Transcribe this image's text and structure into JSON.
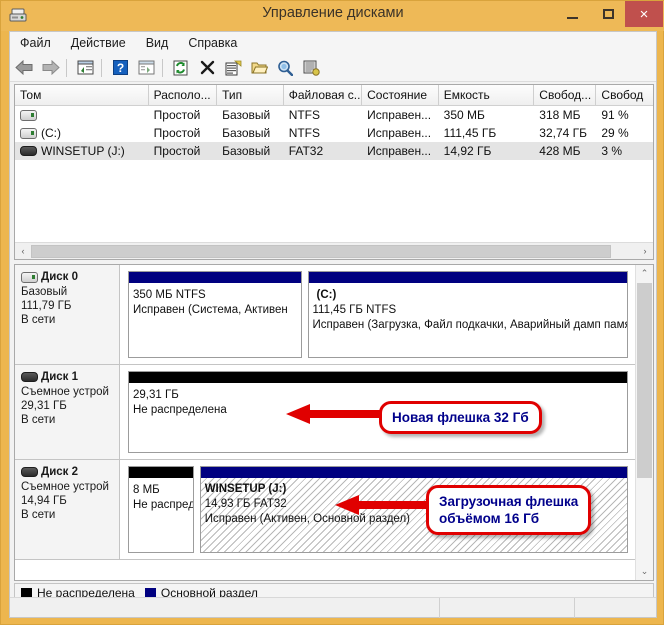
{
  "window": {
    "title": "Управление дисками",
    "icon": "disk-management-icon",
    "minimize_label": "",
    "maximize_label": "",
    "close_label": "×",
    "accent_color": "#eeb957",
    "close_color": "#c0504d"
  },
  "menu": {
    "items": [
      {
        "label": "Файл",
        "name": "menu-file"
      },
      {
        "label": "Действие",
        "name": "menu-action"
      },
      {
        "label": "Вид",
        "name": "menu-view"
      },
      {
        "label": "Справка",
        "name": "menu-help"
      }
    ]
  },
  "toolbar": {
    "buttons": [
      {
        "name": "back-icon"
      },
      {
        "name": "forward-icon"
      },
      {
        "name": "up-one-level-icon"
      },
      {
        "name": "help-icon"
      },
      {
        "name": "show-console-tree-icon"
      },
      {
        "name": "refresh-icon"
      },
      {
        "name": "delete-icon"
      },
      {
        "name": "properties-icon"
      },
      {
        "name": "open-icon"
      },
      {
        "name": "rescan-disks-icon"
      },
      {
        "name": "options-icon"
      }
    ]
  },
  "volume_list": {
    "columns": [
      {
        "label": "Том",
        "width": 147
      },
      {
        "label": "Располо...",
        "width": 75
      },
      {
        "label": "Тип",
        "width": 73
      },
      {
        "label": "Файловая с...",
        "width": 86
      },
      {
        "label": "Состояние",
        "width": 84
      },
      {
        "label": "Емкость",
        "width": 105
      },
      {
        "label": "Свобод...",
        "width": 68
      },
      {
        "label": "Свобод",
        "width": 62
      }
    ],
    "rows": [
      {
        "icon": "hard-disk-volume-icon",
        "name": "",
        "layout": "Простой",
        "type": "Базовый",
        "filesystem": "NTFS",
        "status": "Исправен...",
        "capacity": "350 МБ",
        "free_space": "318 МБ",
        "free_percent": "91 %",
        "selected": false
      },
      {
        "icon": "hard-disk-volume-icon",
        "name": "(C:)",
        "layout": "Простой",
        "type": "Базовый",
        "filesystem": "NTFS",
        "status": "Исправен...",
        "capacity": "111,45 ГБ",
        "free_space": "32,74 ГБ",
        "free_percent": "29 %",
        "selected": false
      },
      {
        "icon": "usb-removable-volume-icon",
        "name": "WINSETUP (J:)",
        "layout": "Простой",
        "type": "Базовый",
        "filesystem": "FAT32",
        "status": "Исправен...",
        "capacity": "14,92 ГБ",
        "free_space": "428 МБ",
        "free_percent": "3 %",
        "selected": true
      }
    ],
    "hscroll": {
      "left_arrow": "‹",
      "right_arrow": "›"
    }
  },
  "disk_pane": {
    "scroll": {
      "up_arrow": "⌃",
      "down_arrow": "⌄"
    },
    "disks": [
      {
        "name": "disk-0",
        "icon": "hard-disk-icon",
        "title": "Диск 0",
        "type": "Базовый",
        "size": "111,79 ГБ",
        "status": "В сети",
        "partitions": [
          {
            "name": "partition-system-reserved",
            "bar_color": "#000080",
            "bar_type": "primary",
            "label": "",
            "size_fs": "350 МБ NTFS",
            "state": "Исправен (Система, Активен",
            "hatched": false,
            "flex": 35
          },
          {
            "name": "partition-c-drive",
            "bar_color": "#000080",
            "bar_type": "primary",
            "label": "(C:)",
            "size_fs": "111,45 ГБ NTFS",
            "state": "Исправен (Загрузка, Файл подкачки, Аварийный дамп памя",
            "hatched": false,
            "flex": 65
          }
        ]
      },
      {
        "name": "disk-1",
        "icon": "usb-removable-icon",
        "title": "Диск 1",
        "type": "Съемное устрой",
        "size": "29,31 ГБ",
        "status": "В сети",
        "partitions": [
          {
            "name": "partition-unallocated-disk1",
            "bar_color": "#000000",
            "bar_type": "unallocated",
            "label": "",
            "size_fs": "29,31 ГБ",
            "state": "Не распределена",
            "hatched": false,
            "flex": 100
          }
        ]
      },
      {
        "name": "disk-2",
        "icon": "usb-removable-icon",
        "title": "Диск 2",
        "type": "Съемное устрой",
        "size": "14,94 ГБ",
        "status": "В сети",
        "partitions": [
          {
            "name": "partition-unallocated-disk2",
            "bar_color": "#000000",
            "bar_type": "unallocated",
            "label": "",
            "size_fs": "8 МБ",
            "state": "Не распред",
            "hatched": false,
            "flex": 13
          },
          {
            "name": "partition-winsetup",
            "bar_color": "#000080",
            "bar_type": "primary",
            "label": "WINSETUP  (J:)",
            "size_fs": "14,93 ГБ FAT32",
            "state": "Исправен (Активен, Основной раздел)",
            "hatched": true,
            "flex": 87
          }
        ]
      }
    ]
  },
  "legend": {
    "items": [
      {
        "label": "Не распределена",
        "color": "#000000",
        "name": "legend-unallocated"
      },
      {
        "label": "Основной раздел",
        "color": "#000080",
        "name": "legend-primary-partition"
      }
    ]
  },
  "callouts": [
    {
      "name": "callout-new-flash-drive",
      "text": "Новая флешка 32 Гб",
      "border_color": "#e00000",
      "text_color": "#00008b"
    },
    {
      "name": "callout-bootable-flash-drive",
      "text": "Загрузочная флешка\nобъёмом 16 Гб",
      "border_color": "#e00000",
      "text_color": "#00008b"
    }
  ],
  "statusbar": {
    "cells": [
      "",
      "",
      ""
    ]
  }
}
